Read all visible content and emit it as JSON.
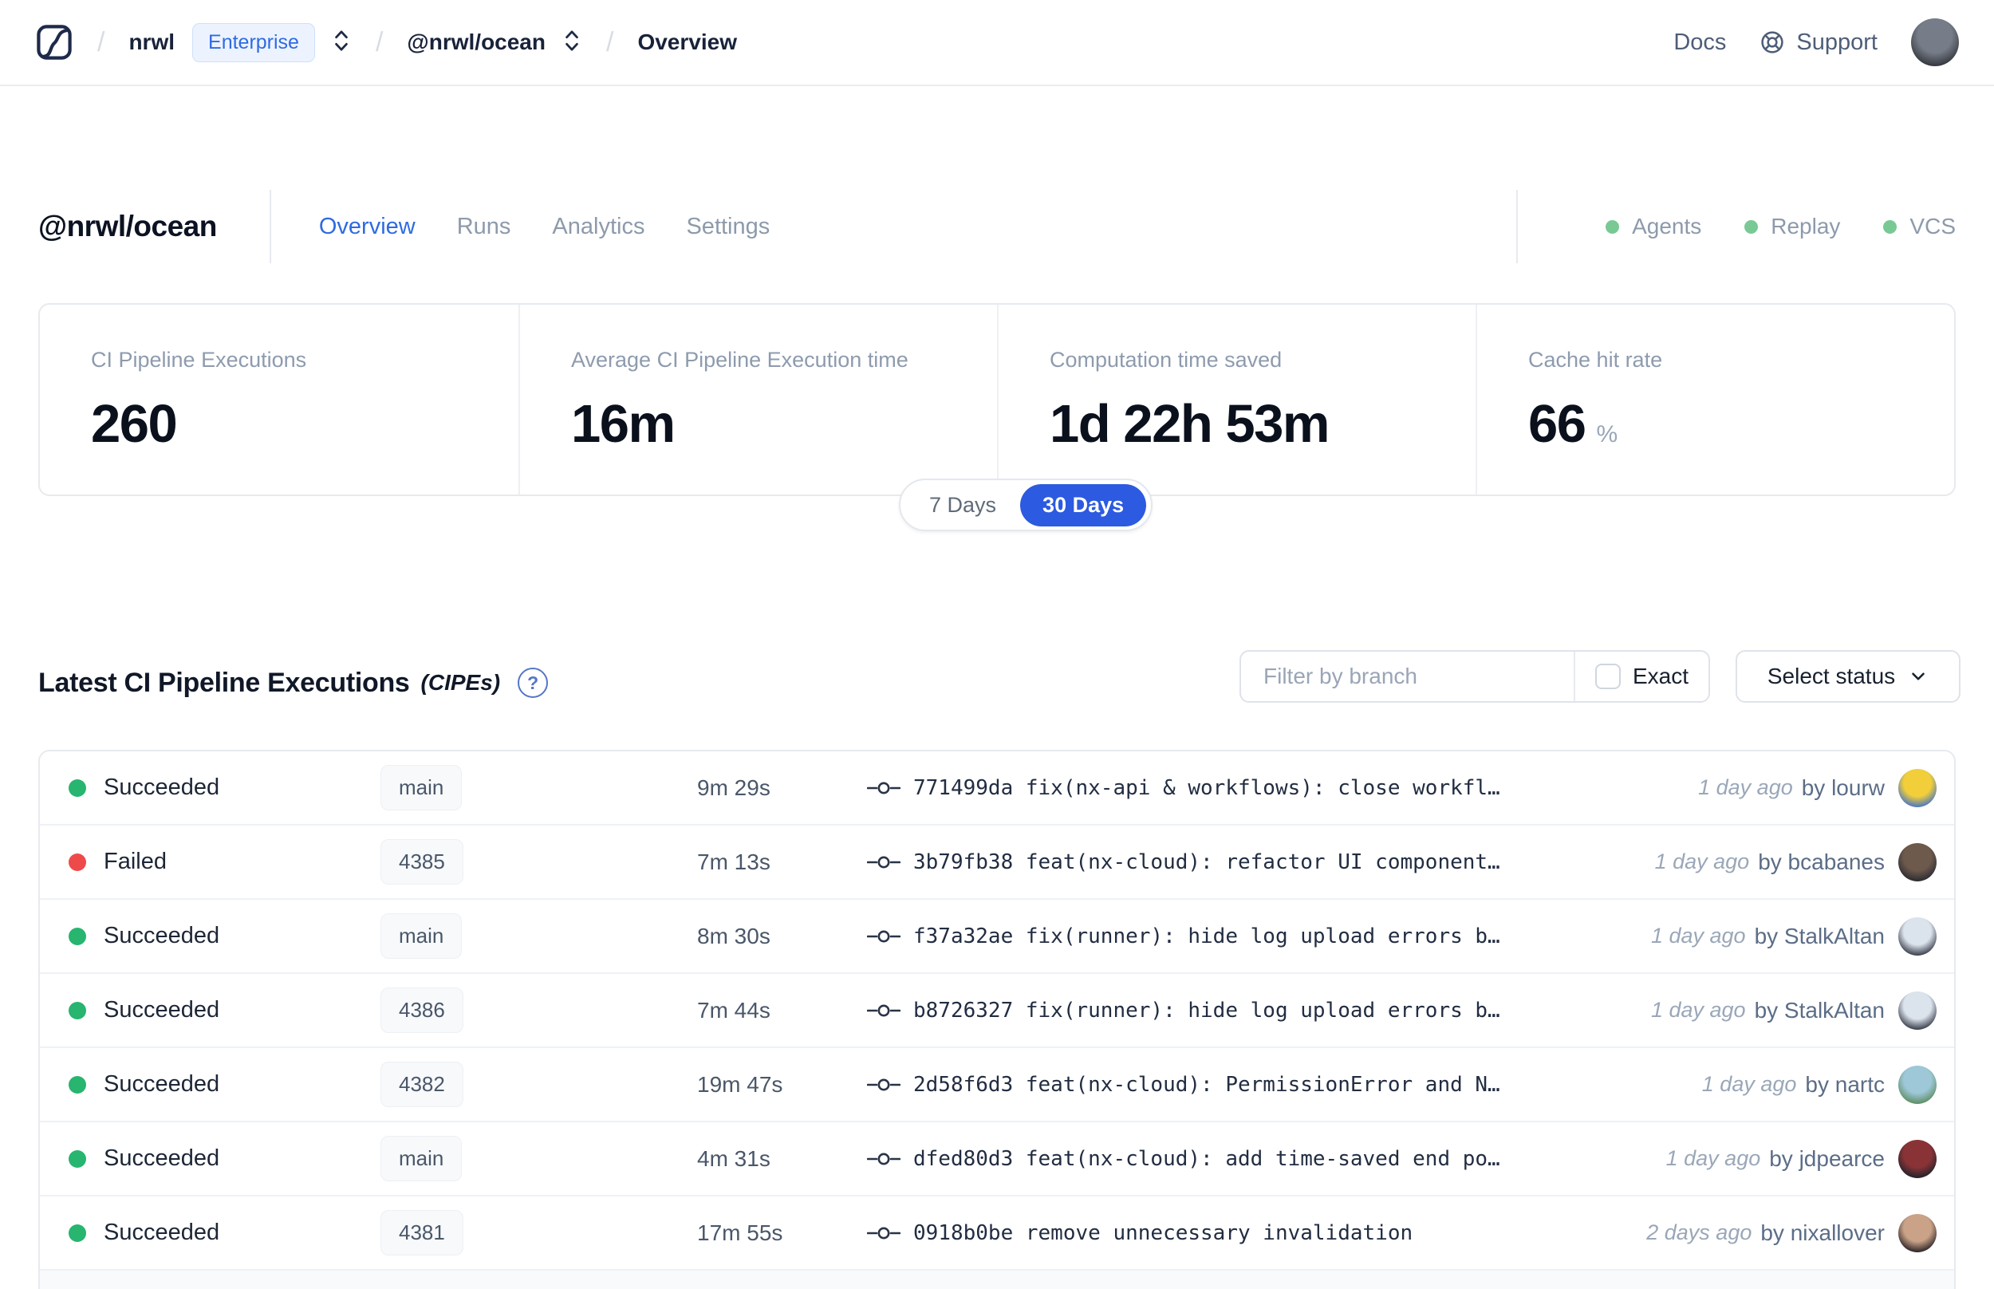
{
  "colors": {
    "accent_blue": "#2e6be2",
    "pill_blue": "#2c5ae0",
    "service_green": "#79c995",
    "success_green": "#27b56f",
    "failed_red": "#ee4a4a"
  },
  "navbar": {
    "breadcrumb": {
      "separator": "/",
      "org": "nrwl",
      "org_badge": "Enterprise",
      "workspace": "@nrwl/ocean",
      "page": "Overview"
    },
    "links": {
      "docs": "Docs",
      "support": "Support"
    }
  },
  "icons": {
    "logo": "nx-cloud-logo",
    "org_selector": "chevron-up-down-icon",
    "workspace_selector": "chevron-up-down-icon",
    "support": "life-ring-icon",
    "help": "question-circle-icon",
    "select_chevron": "chevron-down-icon",
    "commit": "git-commit-icon"
  },
  "header": {
    "title": "@nrwl/ocean",
    "tabs": [
      {
        "label": "Overview",
        "active": true
      },
      {
        "label": "Runs",
        "active": false
      },
      {
        "label": "Analytics",
        "active": false
      },
      {
        "label": "Settings",
        "active": false
      }
    ],
    "services": [
      {
        "label": "Agents"
      },
      {
        "label": "Replay"
      },
      {
        "label": "VCS"
      }
    ]
  },
  "stats": {
    "cards": [
      {
        "label": "CI Pipeline Executions",
        "value": "260"
      },
      {
        "label": "Average CI Pipeline Execution time",
        "value": "16m"
      },
      {
        "label": "Computation time saved",
        "value": "1d 22h 53m"
      },
      {
        "label": "Cache hit rate",
        "value": "66",
        "suffix": "%"
      }
    ],
    "range_toggle": {
      "options": [
        "7 Days",
        "30 Days"
      ],
      "selected": "30 Days"
    }
  },
  "cipes": {
    "title": "Latest CI Pipeline Executions",
    "title_suffix": "(CIPEs)",
    "help_glyph": "?",
    "filter": {
      "placeholder": "Filter by branch",
      "exact_label": "Exact",
      "exact_checked": false,
      "status_dropdown": "Select status"
    },
    "status_colors": {
      "Succeeded": "#27b56f",
      "Failed": "#ee4a4a"
    },
    "rows": [
      {
        "status": "Succeeded",
        "branch": "main",
        "duration": "9m 29s",
        "commit": "771499da fix(nx-api & workflows): close workfl…",
        "ago": "1 day ago",
        "author": "by lourw",
        "avatar_colors": [
          "#f2cf3a",
          "#4d79c0"
        ]
      },
      {
        "status": "Failed",
        "branch": "4385",
        "duration": "7m 13s",
        "commit": "3b79fb38 feat(nx-cloud): refactor UI component…",
        "ago": "1 day ago",
        "author": "by bcabanes",
        "avatar_colors": [
          "#6d5a4c",
          "#2c2c33"
        ]
      },
      {
        "status": "Succeeded",
        "branch": "main",
        "duration": "8m 30s",
        "commit": "f37a32ae fix(runner): hide log upload errors b…",
        "ago": "1 day ago",
        "author": "by StalkAltan",
        "avatar_colors": [
          "#dbe3ec",
          "#3c414d"
        ]
      },
      {
        "status": "Succeeded",
        "branch": "4386",
        "duration": "7m 44s",
        "commit": "b8726327 fix(runner): hide log upload errors b…",
        "ago": "1 day ago",
        "author": "by StalkAltan",
        "avatar_colors": [
          "#dbe3ec",
          "#3c414d"
        ]
      },
      {
        "status": "Succeeded",
        "branch": "4382",
        "duration": "19m 47s",
        "commit": "2d58f6d3 feat(nx-cloud): PermissionError and N…",
        "ago": "1 day ago",
        "author": "by nartc",
        "avatar_colors": [
          "#9ec7d8",
          "#5f8f66"
        ]
      },
      {
        "status": "Succeeded",
        "branch": "main",
        "duration": "4m 31s",
        "commit": "dfed80d3 feat(nx-cloud): add time-saved end po…",
        "ago": "1 day ago",
        "author": "by jdpearce",
        "avatar_colors": [
          "#8a3337",
          "#23232a"
        ]
      },
      {
        "status": "Succeeded",
        "branch": "4381",
        "duration": "17m 55s",
        "commit": "0918b0be remove unnecessary invalidation",
        "ago": "2 days ago",
        "author": "by nixallover",
        "avatar_colors": [
          "#c9a287",
          "#2e2629"
        ]
      }
    ]
  },
  "user": {
    "avatar_colors": [
      "#767d88",
      "#35383f"
    ]
  }
}
